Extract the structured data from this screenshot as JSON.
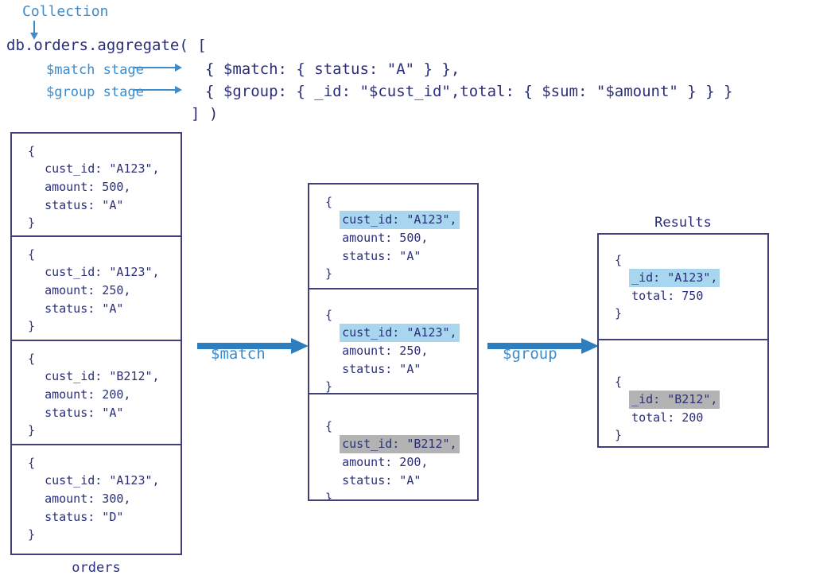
{
  "header": {
    "collection_label": "Collection",
    "code_lines": [
      "db.orders.aggregate( [",
      "{ $match: { status: \"A\" } },",
      "{ $group: { _id: \"$cust_id\",total: { $sum: \"$amount\" } } }",
      "] )"
    ],
    "annotations": [
      {
        "label": "$match stage"
      },
      {
        "label": "$group stage"
      }
    ]
  },
  "input_stack": {
    "caption": "orders",
    "documents": [
      {
        "open_brace": "{",
        "close_brace": "}",
        "fields": [
          {
            "text": "cust_id: \"A123\",",
            "highlight": "none"
          },
          {
            "text": "amount: 500,",
            "highlight": "none"
          },
          {
            "text": "status: \"A\"",
            "highlight": "none"
          }
        ]
      },
      {
        "open_brace": "{",
        "close_brace": "}",
        "fields": [
          {
            "text": "cust_id: \"A123\",",
            "highlight": "none"
          },
          {
            "text": "amount: 250,",
            "highlight": "none"
          },
          {
            "text": "status: \"A\"",
            "highlight": "none"
          }
        ]
      },
      {
        "open_brace": "{",
        "close_brace": "}",
        "fields": [
          {
            "text": "cust_id: \"B212\",",
            "highlight": "none"
          },
          {
            "text": "amount: 200,",
            "highlight": "none"
          },
          {
            "text": "status: \"A\"",
            "highlight": "none"
          }
        ]
      },
      {
        "open_brace": "{",
        "close_brace": "}",
        "fields": [
          {
            "text": "cust_id: \"A123\",",
            "highlight": "none"
          },
          {
            "text": "amount: 300,",
            "highlight": "none"
          },
          {
            "text": "status: \"D\"",
            "highlight": "none"
          }
        ]
      }
    ]
  },
  "match_stack": {
    "caption": "",
    "documents": [
      {
        "open_brace": "{",
        "close_brace": "}",
        "fields": [
          {
            "text": "cust_id: \"A123\",",
            "highlight": "blue"
          },
          {
            "text": "amount: 500,",
            "highlight": "none"
          },
          {
            "text": "status: \"A\"",
            "highlight": "none"
          }
        ]
      },
      {
        "open_brace": "{",
        "close_brace": "}",
        "fields": [
          {
            "text": "cust_id: \"A123\",",
            "highlight": "blue"
          },
          {
            "text": "amount: 250,",
            "highlight": "none"
          },
          {
            "text": "status: \"A\"",
            "highlight": "none"
          }
        ]
      },
      {
        "open_brace": "{",
        "close_brace": "}",
        "fields": [
          {
            "text": "cust_id: \"B212\",",
            "highlight": "gray"
          },
          {
            "text": "amount: 200,",
            "highlight": "none"
          },
          {
            "text": "status: \"A\"",
            "highlight": "none"
          }
        ]
      }
    ]
  },
  "results_stack": {
    "caption": "Results",
    "documents": [
      {
        "open_brace": "{",
        "close_brace": "}",
        "fields": [
          {
            "text": "_id: \"A123\",",
            "highlight": "blue"
          },
          {
            "text": "total: 750",
            "highlight": "none"
          }
        ]
      },
      {
        "open_brace": "{",
        "close_brace": "}",
        "fields": [
          {
            "text": "_id: \"B212\",",
            "highlight": "gray"
          },
          {
            "text": "total: 200",
            "highlight": "none"
          }
        ]
      }
    ]
  },
  "stage_arrows": [
    {
      "label": "$match"
    },
    {
      "label": "$group"
    }
  ],
  "colors": {
    "code_text": "#2b2f7a",
    "annotation": "#3f8ccb",
    "arrow": "#2d7ebf",
    "box_border": "#3f3f7a",
    "highlight_blue": "#a9d6ef",
    "highlight_gray": "#b3b3b3"
  }
}
